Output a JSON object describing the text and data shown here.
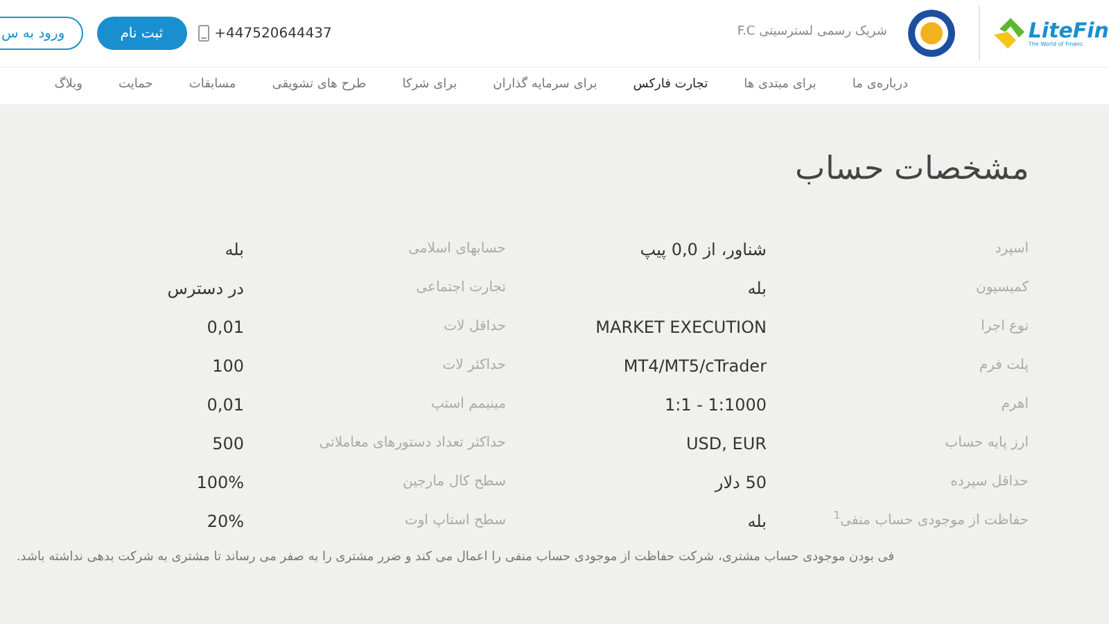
{
  "header": {
    "logo": {
      "name": "LiteFin",
      "tagline": "The World of Financ"
    },
    "partner_text": "شریک رسمی لسترسیتی F.C",
    "phone": "+447520644437",
    "signup_button": "ثبت نام",
    "login_button": "ورود به س"
  },
  "nav": [
    {
      "label": "درباره‌ی ما",
      "selected": false
    },
    {
      "label": "برای مبتدی ها",
      "selected": false
    },
    {
      "label": "تجارت فارکس",
      "selected": true
    },
    {
      "label": "برای سرمایه گذاران",
      "selected": false
    },
    {
      "label": "برای شرکا",
      "selected": false
    },
    {
      "label": "طرح های تشویقی",
      "selected": false
    },
    {
      "label": "مسابقات",
      "selected": false
    },
    {
      "label": "حمایت",
      "selected": false
    },
    {
      "label": "وبلاگ",
      "selected": false
    }
  ],
  "title": "مشخصات حساب",
  "specs_right": [
    {
      "label": "اسپرد",
      "value": "شناور، از 0,0 پیپ"
    },
    {
      "label": "کمیسیون",
      "value": "بله"
    },
    {
      "label": "نوع اجرا",
      "value": "MARKET EXECUTION"
    },
    {
      "label": "پلت فرم",
      "value": "MT4/MT5/cTrader"
    },
    {
      "label": "اهرم",
      "value": "1:1 - 1:1000"
    },
    {
      "label": "ارز پایه حساب",
      "value": "USD, EUR"
    },
    {
      "label": "حداقل سپرده",
      "value": "50 دلار"
    },
    {
      "label": "حفاظت از موجودی حساب منفی$^{1}$",
      "value": "بله"
    }
  ],
  "specs_left": [
    {
      "label": "حسابهای اسلامی",
      "value": "بله"
    },
    {
      "label": "تجارت اجتماعی",
      "value": "در دسترس"
    },
    {
      "label": "حداقل لات",
      "value": "0,01"
    },
    {
      "label": "حداکثر لات",
      "value": "100"
    },
    {
      "label": "مینیمم استپ",
      "value": "0,01"
    },
    {
      "label": "حداکثر تعداد دستورهای معاملاتی",
      "value": "500"
    },
    {
      "label": "سطح کال مارجین",
      "value": "100%"
    },
    {
      "label": "سطح استاپ اوت",
      "value": "20%"
    }
  ],
  "footnote": "فی بودن موجودی حساب مشتری، شرکت حفاظت از موجودی حساب منفی را اعمال می کند و ضرر مشتری را به صفر می رساند تا مشتری به شرکت بدهی نداشته باشد."
}
